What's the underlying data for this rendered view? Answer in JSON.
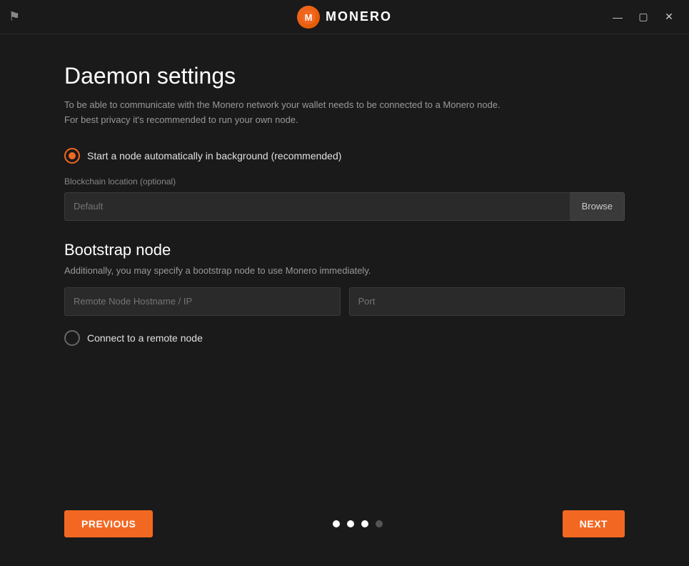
{
  "titlebar": {
    "title": "MONERO",
    "logo_letter": "M",
    "minimize_label": "minimize",
    "maximize_label": "maximize",
    "close_label": "close"
  },
  "page": {
    "title": "Daemon settings",
    "description_line1": "To be able to communicate with the Monero network your wallet needs to be connected to a Monero node.",
    "description_line2": "For best privacy it's recommended to run your own node."
  },
  "auto_node": {
    "label": "Start a node automatically in background (recommended)",
    "selected": true
  },
  "blockchain": {
    "label": "Blockchain location (optional)",
    "placeholder": "Default",
    "browse_label": "Browse"
  },
  "bootstrap": {
    "title": "Bootstrap node",
    "description": "Additionally, you may specify a bootstrap node to use Monero immediately.",
    "hostname_placeholder": "Remote Node Hostname / IP",
    "port_placeholder": "Port"
  },
  "remote_node": {
    "label": "Connect to a remote node",
    "selected": false
  },
  "navigation": {
    "previous_label": "Previous",
    "next_label": "Next",
    "dots": [
      {
        "active": true
      },
      {
        "active": true
      },
      {
        "active": true
      },
      {
        "active": false
      }
    ]
  }
}
